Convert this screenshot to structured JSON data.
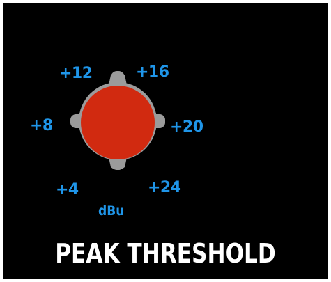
{
  "control": {
    "title": "PEAK THRESHOLD",
    "unit": "dBu",
    "scale_labels": [
      "+4",
      "+8",
      "+12",
      "+16",
      "+20",
      "+24"
    ],
    "knob_position_label": "+12",
    "colors": {
      "background": "#000000",
      "label": "#1f95e8",
      "title": "#ffffff",
      "knob_body": "#9b9b9b",
      "knob_cap": "#d12a10"
    }
  }
}
